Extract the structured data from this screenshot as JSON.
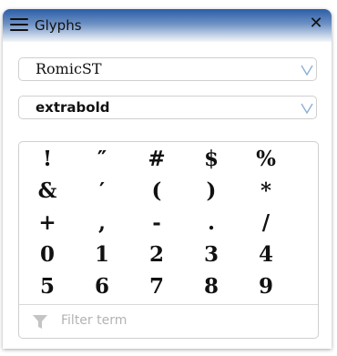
{
  "window": {
    "title": "Glyphs",
    "close_label": "✕"
  },
  "font_select": {
    "value": "RomicST"
  },
  "weight_select": {
    "value": "extrabold"
  },
  "glyphs": [
    "!",
    "″",
    "#",
    "$",
    "%",
    "&",
    "′",
    "(",
    ")",
    "*",
    "+",
    ",",
    "-",
    ".",
    "/",
    "0",
    "1",
    "2",
    "3",
    "4",
    "5",
    "6",
    "7",
    "8",
    "9"
  ],
  "filter": {
    "placeholder": "Filter term",
    "value": ""
  },
  "icons": {
    "menu": "hamburger-icon",
    "close": "close-icon",
    "dropdown": "chevron-down-icon",
    "filter": "funnel-icon"
  },
  "colors": {
    "titlebar_top": "#2b5ea8",
    "titlebar_bottom": "#f4f6fa",
    "chevron": "#8ab0d8",
    "placeholder": "#b3b3b3",
    "filter_icon": "#c4c4c4"
  }
}
